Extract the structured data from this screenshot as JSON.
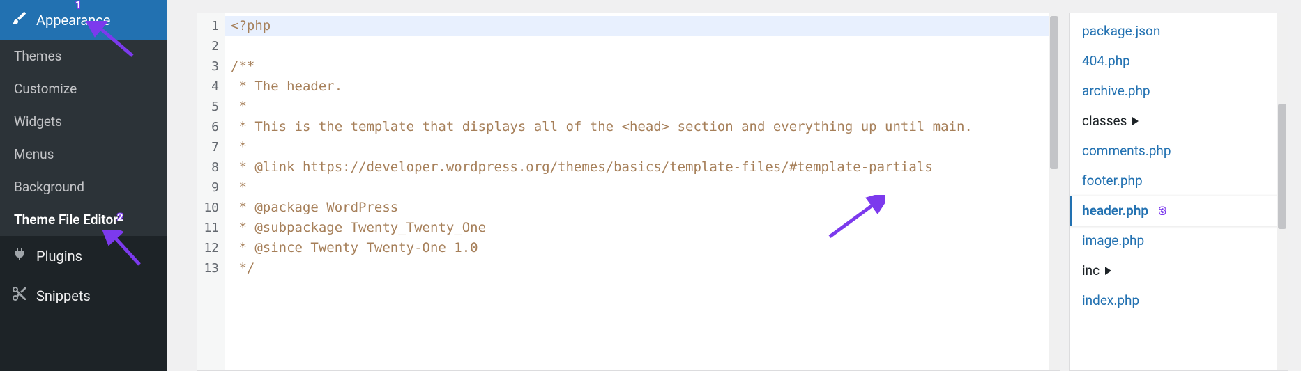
{
  "sidebar": {
    "appearance_label": "Appearance",
    "subitems": [
      {
        "label": "Themes"
      },
      {
        "label": "Customize"
      },
      {
        "label": "Widgets"
      },
      {
        "label": "Menus"
      },
      {
        "label": "Background"
      },
      {
        "label": "Theme File Editor",
        "active": true
      }
    ],
    "plugins_label": "Plugins",
    "snippets_label": "Snippets"
  },
  "editor": {
    "line_numbers": [
      "1",
      "2",
      "3",
      "4",
      "5",
      "6",
      "7",
      "8",
      "9",
      "10",
      "11",
      "12",
      "13"
    ],
    "lines": [
      {
        "type": "meta",
        "text": "<?php",
        "active": true
      },
      {
        "type": "comment",
        "text": "/**"
      },
      {
        "type": "comment",
        "text": " * The header."
      },
      {
        "type": "comment",
        "text": " *"
      },
      {
        "type": "comment",
        "text": " * This is the template that displays all of the <head> section and everything up until main."
      },
      {
        "type": "comment",
        "text": " *"
      },
      {
        "type": "comment",
        "text": " * @link https://developer.wordpress.org/themes/basics/template-files/#template-partials"
      },
      {
        "type": "comment",
        "text": " *"
      },
      {
        "type": "comment",
        "text": " * @package WordPress"
      },
      {
        "type": "comment",
        "text": " * @subpackage Twenty_Twenty_One"
      },
      {
        "type": "comment",
        "text": " * @since Twenty Twenty-One 1.0"
      },
      {
        "type": "comment",
        "text": " */"
      },
      {
        "type": "plain",
        "text": ""
      }
    ]
  },
  "file_tree": {
    "items": [
      {
        "label": "package.json",
        "kind": "file"
      },
      {
        "label": "404.php",
        "kind": "file"
      },
      {
        "label": "archive.php",
        "kind": "file"
      },
      {
        "label": "classes",
        "kind": "folder"
      },
      {
        "label": "comments.php",
        "kind": "file"
      },
      {
        "label": "footer.php",
        "kind": "file"
      },
      {
        "label": "header.php",
        "kind": "file",
        "active": true
      },
      {
        "label": "image.php",
        "kind": "file"
      },
      {
        "label": "inc",
        "kind": "folder"
      },
      {
        "label": "index.php",
        "kind": "file"
      }
    ]
  },
  "annotations": {
    "badge1": "1",
    "badge2": "2",
    "badge3": "3"
  }
}
